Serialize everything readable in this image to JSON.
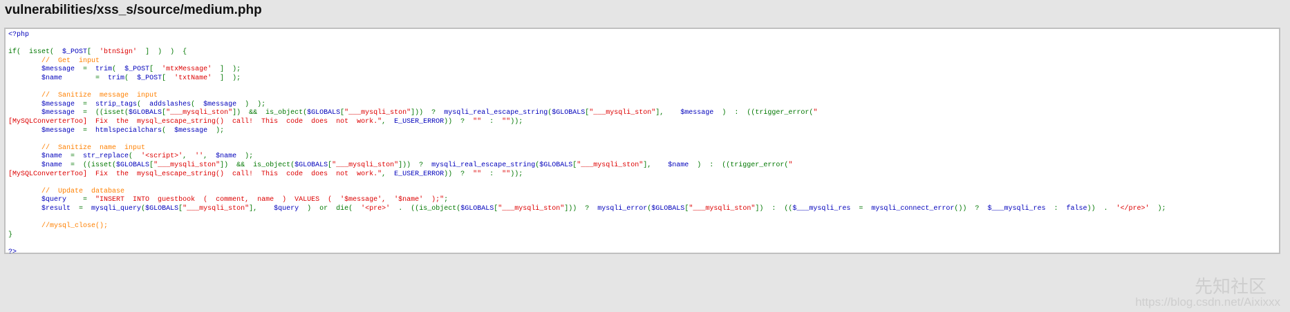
{
  "header": {
    "title": "vulnerabilities/xss_s/source/medium.php"
  },
  "colors": {
    "keyword": "#007700",
    "default": "#0000BB",
    "string": "#DD0000",
    "comment": "#FF8000",
    "background": "#e5e5e5"
  },
  "code": {
    "lines": [
      [
        [
          "d",
          "<?php"
        ]
      ],
      [],
      [
        [
          "k",
          "if(  isset(  "
        ],
        [
          "d",
          "$_POST"
        ],
        [
          "k",
          "[  "
        ],
        [
          "s",
          "'btnSign'"
        ],
        [
          "k",
          "  ]  )  )  {"
        ]
      ],
      [
        [
          "c",
          "        //  Get  input"
        ]
      ],
      [
        [
          "d",
          "        $message  "
        ],
        [
          "k",
          "=  "
        ],
        [
          "d",
          "trim"
        ],
        [
          "k",
          "(  "
        ],
        [
          "d",
          "$_POST"
        ],
        [
          "k",
          "[  "
        ],
        [
          "s",
          "'mtxMessage'"
        ],
        [
          "k",
          "  ]  );"
        ]
      ],
      [
        [
          "d",
          "        $name        "
        ],
        [
          "k",
          "=  "
        ],
        [
          "d",
          "trim"
        ],
        [
          "k",
          "(  "
        ],
        [
          "d",
          "$_POST"
        ],
        [
          "k",
          "[  "
        ],
        [
          "s",
          "'txtName'"
        ],
        [
          "k",
          "  ]  );"
        ]
      ],
      [],
      [
        [
          "c",
          "        //  Sanitize  message  input"
        ]
      ],
      [
        [
          "d",
          "        $message  "
        ],
        [
          "k",
          "=  "
        ],
        [
          "d",
          "strip_tags"
        ],
        [
          "k",
          "(  "
        ],
        [
          "d",
          "addslashes"
        ],
        [
          "k",
          "(  "
        ],
        [
          "d",
          "$message  "
        ],
        [
          "k",
          ")  );"
        ]
      ],
      [
        [
          "d",
          "        $message  "
        ],
        [
          "k",
          "=  ((isset("
        ],
        [
          "d",
          "$GLOBALS"
        ],
        [
          "k",
          "["
        ],
        [
          "s",
          "\"___mysqli_ston\""
        ],
        [
          "k",
          "])  &&  is_object("
        ],
        [
          "d",
          "$GLOBALS"
        ],
        [
          "k",
          "["
        ],
        [
          "s",
          "\"___mysqli_ston\""
        ],
        [
          "k",
          "]))  ?  "
        ],
        [
          "d",
          "mysqli_real_escape_string"
        ],
        [
          "k",
          "("
        ],
        [
          "d",
          "$GLOBALS"
        ],
        [
          "k",
          "["
        ],
        [
          "s",
          "\"___mysqli_ston\""
        ],
        [
          "k",
          "],    "
        ],
        [
          "d",
          "$message  "
        ],
        [
          "k",
          ")  :  ((trigger_error("
        ],
        [
          "s",
          "\""
        ]
      ],
      [
        [
          "s",
          "[MySQLConverterToo]  Fix  the  mysql_escape_string()  call!  This  code  does  not  work.\""
        ],
        [
          "k",
          ",  "
        ],
        [
          "d",
          "E_USER_ERROR"
        ],
        [
          "k",
          "))  ?  "
        ],
        [
          "s",
          "\"\""
        ],
        [
          "k",
          "  :  "
        ],
        [
          "s",
          "\"\""
        ],
        [
          "k",
          "));"
        ]
      ],
      [
        [
          "d",
          "        $message  "
        ],
        [
          "k",
          "=  "
        ],
        [
          "d",
          "htmlspecialchars"
        ],
        [
          "k",
          "(  "
        ],
        [
          "d",
          "$message  "
        ],
        [
          "k",
          ");"
        ]
      ],
      [],
      [
        [
          "c",
          "        //  Sanitize  name  input"
        ]
      ],
      [
        [
          "d",
          "        $name  "
        ],
        [
          "k",
          "=  "
        ],
        [
          "d",
          "str_replace"
        ],
        [
          "k",
          "(  "
        ],
        [
          "s",
          "'<script>'"
        ],
        [
          "k",
          ",  "
        ],
        [
          "s",
          "''"
        ],
        [
          "k",
          ",  "
        ],
        [
          "d",
          "$name  "
        ],
        [
          "k",
          ");"
        ]
      ],
      [
        [
          "d",
          "        $name  "
        ],
        [
          "k",
          "=  ((isset("
        ],
        [
          "d",
          "$GLOBALS"
        ],
        [
          "k",
          "["
        ],
        [
          "s",
          "\"___mysqli_ston\""
        ],
        [
          "k",
          "])  &&  is_object("
        ],
        [
          "d",
          "$GLOBALS"
        ],
        [
          "k",
          "["
        ],
        [
          "s",
          "\"___mysqli_ston\""
        ],
        [
          "k",
          "]))  ?  "
        ],
        [
          "d",
          "mysqli_real_escape_string"
        ],
        [
          "k",
          "("
        ],
        [
          "d",
          "$GLOBALS"
        ],
        [
          "k",
          "["
        ],
        [
          "s",
          "\"___mysqli_ston\""
        ],
        [
          "k",
          "],    "
        ],
        [
          "d",
          "$name  "
        ],
        [
          "k",
          ")  :  ((trigger_error("
        ],
        [
          "s",
          "\""
        ]
      ],
      [
        [
          "s",
          "[MySQLConverterToo]  Fix  the  mysql_escape_string()  call!  This  code  does  not  work.\""
        ],
        [
          "k",
          ",  "
        ],
        [
          "d",
          "E_USER_ERROR"
        ],
        [
          "k",
          "))  ?  "
        ],
        [
          "s",
          "\"\""
        ],
        [
          "k",
          "  :  "
        ],
        [
          "s",
          "\"\""
        ],
        [
          "k",
          "));"
        ]
      ],
      [],
      [
        [
          "c",
          "        //  Update  database"
        ]
      ],
      [
        [
          "d",
          "        $query    "
        ],
        [
          "k",
          "=  "
        ],
        [
          "s",
          "\"INSERT  INTO  guestbook  (  comment,  name  )  VALUES  (  '$message',  '$name'  );\""
        ],
        [
          "k",
          ";"
        ]
      ],
      [
        [
          "d",
          "        $result  "
        ],
        [
          "k",
          "=  "
        ],
        [
          "d",
          "mysqli_query"
        ],
        [
          "k",
          "("
        ],
        [
          "d",
          "$GLOBALS"
        ],
        [
          "k",
          "["
        ],
        [
          "s",
          "\"___mysqli_ston\""
        ],
        [
          "k",
          "],    "
        ],
        [
          "d",
          "$query  "
        ],
        [
          "k",
          ")  or  die(  "
        ],
        [
          "s",
          "'<pre>'  "
        ],
        [
          "k",
          ".  ((is_object("
        ],
        [
          "d",
          "$GLOBALS"
        ],
        [
          "k",
          "["
        ],
        [
          "s",
          "\"___mysqli_ston\""
        ],
        [
          "k",
          "]))  ?  "
        ],
        [
          "d",
          "mysqli_error"
        ],
        [
          "k",
          "("
        ],
        [
          "d",
          "$GLOBALS"
        ],
        [
          "k",
          "["
        ],
        [
          "s",
          "\"___mysqli_ston\""
        ],
        [
          "k",
          "])  :  (("
        ],
        [
          "d",
          "$___mysqli_res  "
        ],
        [
          "k",
          "=  "
        ],
        [
          "d",
          "mysqli_connect_error"
        ],
        [
          "k",
          "())  ?  "
        ],
        [
          "d",
          "$___mysqli_res  "
        ],
        [
          "k",
          ":  "
        ],
        [
          "d",
          "false"
        ],
        [
          "k",
          "))  .  "
        ],
        [
          "s",
          "'</pre>'"
        ],
        [
          "k",
          "  );"
        ]
      ],
      [],
      [
        [
          "c",
          "        //mysql_close();"
        ]
      ],
      [
        [
          "k",
          "}"
        ]
      ],
      [],
      [
        [
          "d",
          "?>"
        ]
      ]
    ]
  },
  "watermark": {
    "site": "先知社区",
    "url": "https://blog.csdn.net/Aixixxx"
  }
}
